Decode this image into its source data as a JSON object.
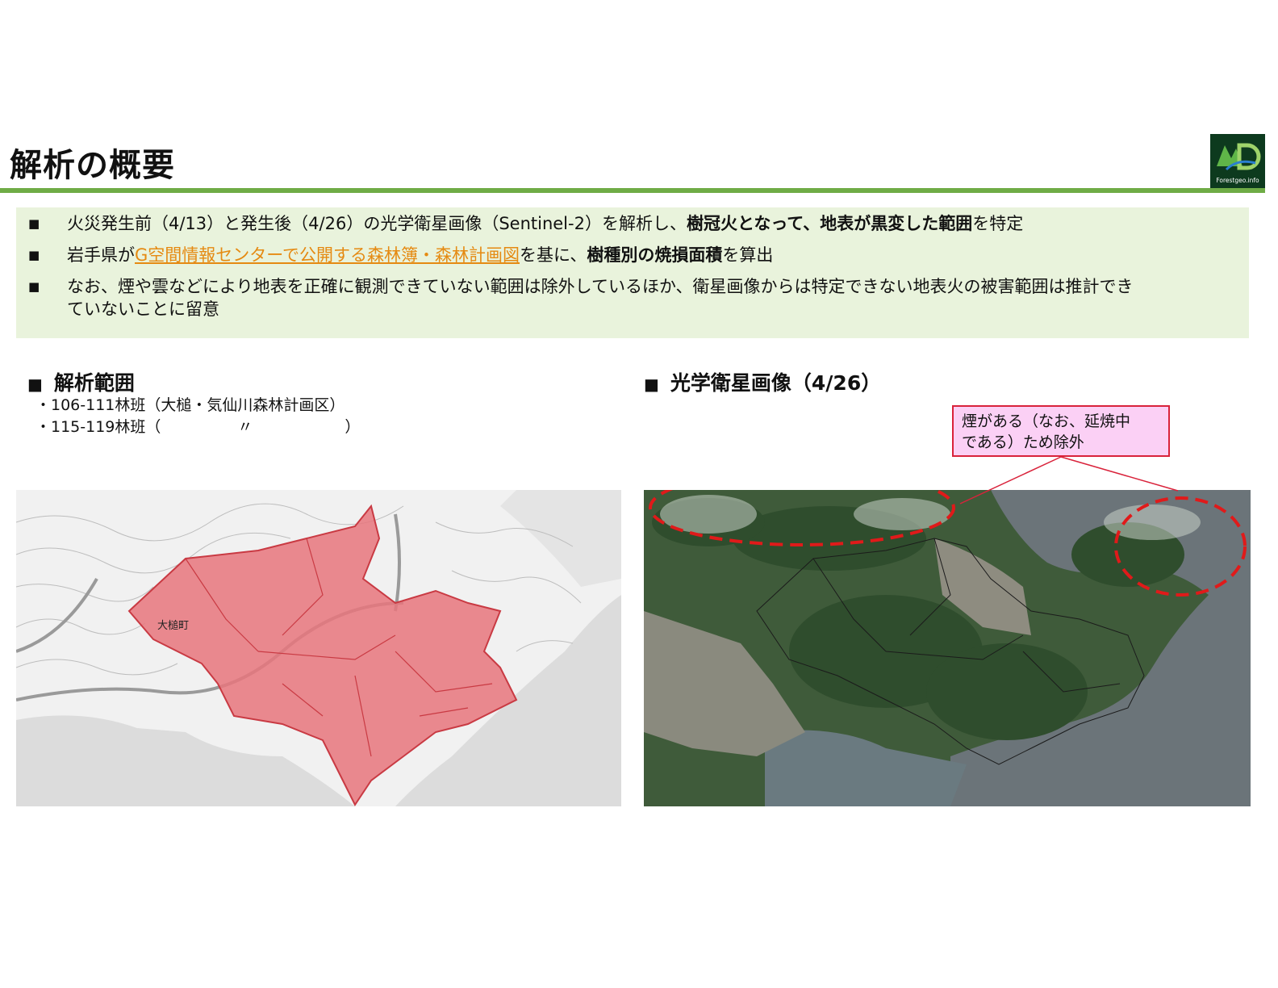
{
  "title": "解析の概要",
  "logo": {
    "text": "Forestgeo.info",
    "icon": "forestgeo-logo-icon"
  },
  "summary": {
    "bullet_marker": "■",
    "bullet1": {
      "part1": "火災発生前（4/13）と発生後（4/26）の光学衛星画像（Sentinel-2）を解析し、",
      "bold": "樹冠火となって、地表が黒変した範囲",
      "part2": "を特定"
    },
    "bullet2": {
      "part1": "岩手県が",
      "link": "G空間情報センターで公開する森林簿・森林計画図",
      "part2": "を基に、",
      "bold": "樹種別の焼損面積",
      "part3": "を算出"
    },
    "bullet3": {
      "line1": "なお、煙や雲などにより地表を正確に観測できていない範囲は除外しているほか、衛星画像からは特定できない地表火の被害範囲は推計でき",
      "line2": "ていないことに留意"
    }
  },
  "analysis_range": {
    "heading": "解析範囲",
    "item1": "・106-111林班（大槌・気仙川森林計画区）",
    "item2": "・115-119林班（　　　　　〃　　　　　　）"
  },
  "map_panel": {
    "town_label": "大槌町"
  },
  "satellite": {
    "heading": "光学衛星画像（4/26）",
    "callout_line1": "煙がある（なお、延焼中",
    "callout_line2": "である）ため除外"
  },
  "colors": {
    "accent_green": "#6fac46",
    "summary_bg": "#e9f3dc",
    "link_orange": "#e58a12",
    "burn_red": "#e8767c",
    "callout_border": "#d9233b",
    "callout_bg": "#fbd0f5"
  }
}
